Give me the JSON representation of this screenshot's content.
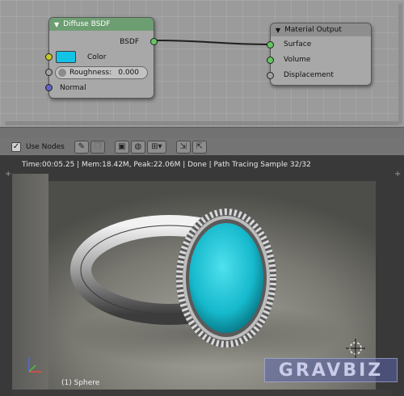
{
  "node_editor": {
    "diffuse_node": {
      "title": "Diffuse BSDF",
      "output_label": "BSDF",
      "color_label": "Color",
      "color_value": "#13c3e6",
      "roughness_label": "Roughness:",
      "roughness_value": "0.000",
      "normal_label": "Normal"
    },
    "output_node": {
      "title": "Material Output",
      "inputs": [
        "Surface",
        "Volume",
        "Displacement"
      ]
    }
  },
  "toolbar": {
    "use_nodes_label": "Use Nodes",
    "use_nodes_checked": "✓"
  },
  "viewport": {
    "status": "Time:00:05.25 | Mem:18.42M, Peak:22.06M | Done | Path Tracing Sample 32/32",
    "object_name": "(1) Sphere",
    "watermark": "GRAVBIZ"
  }
}
